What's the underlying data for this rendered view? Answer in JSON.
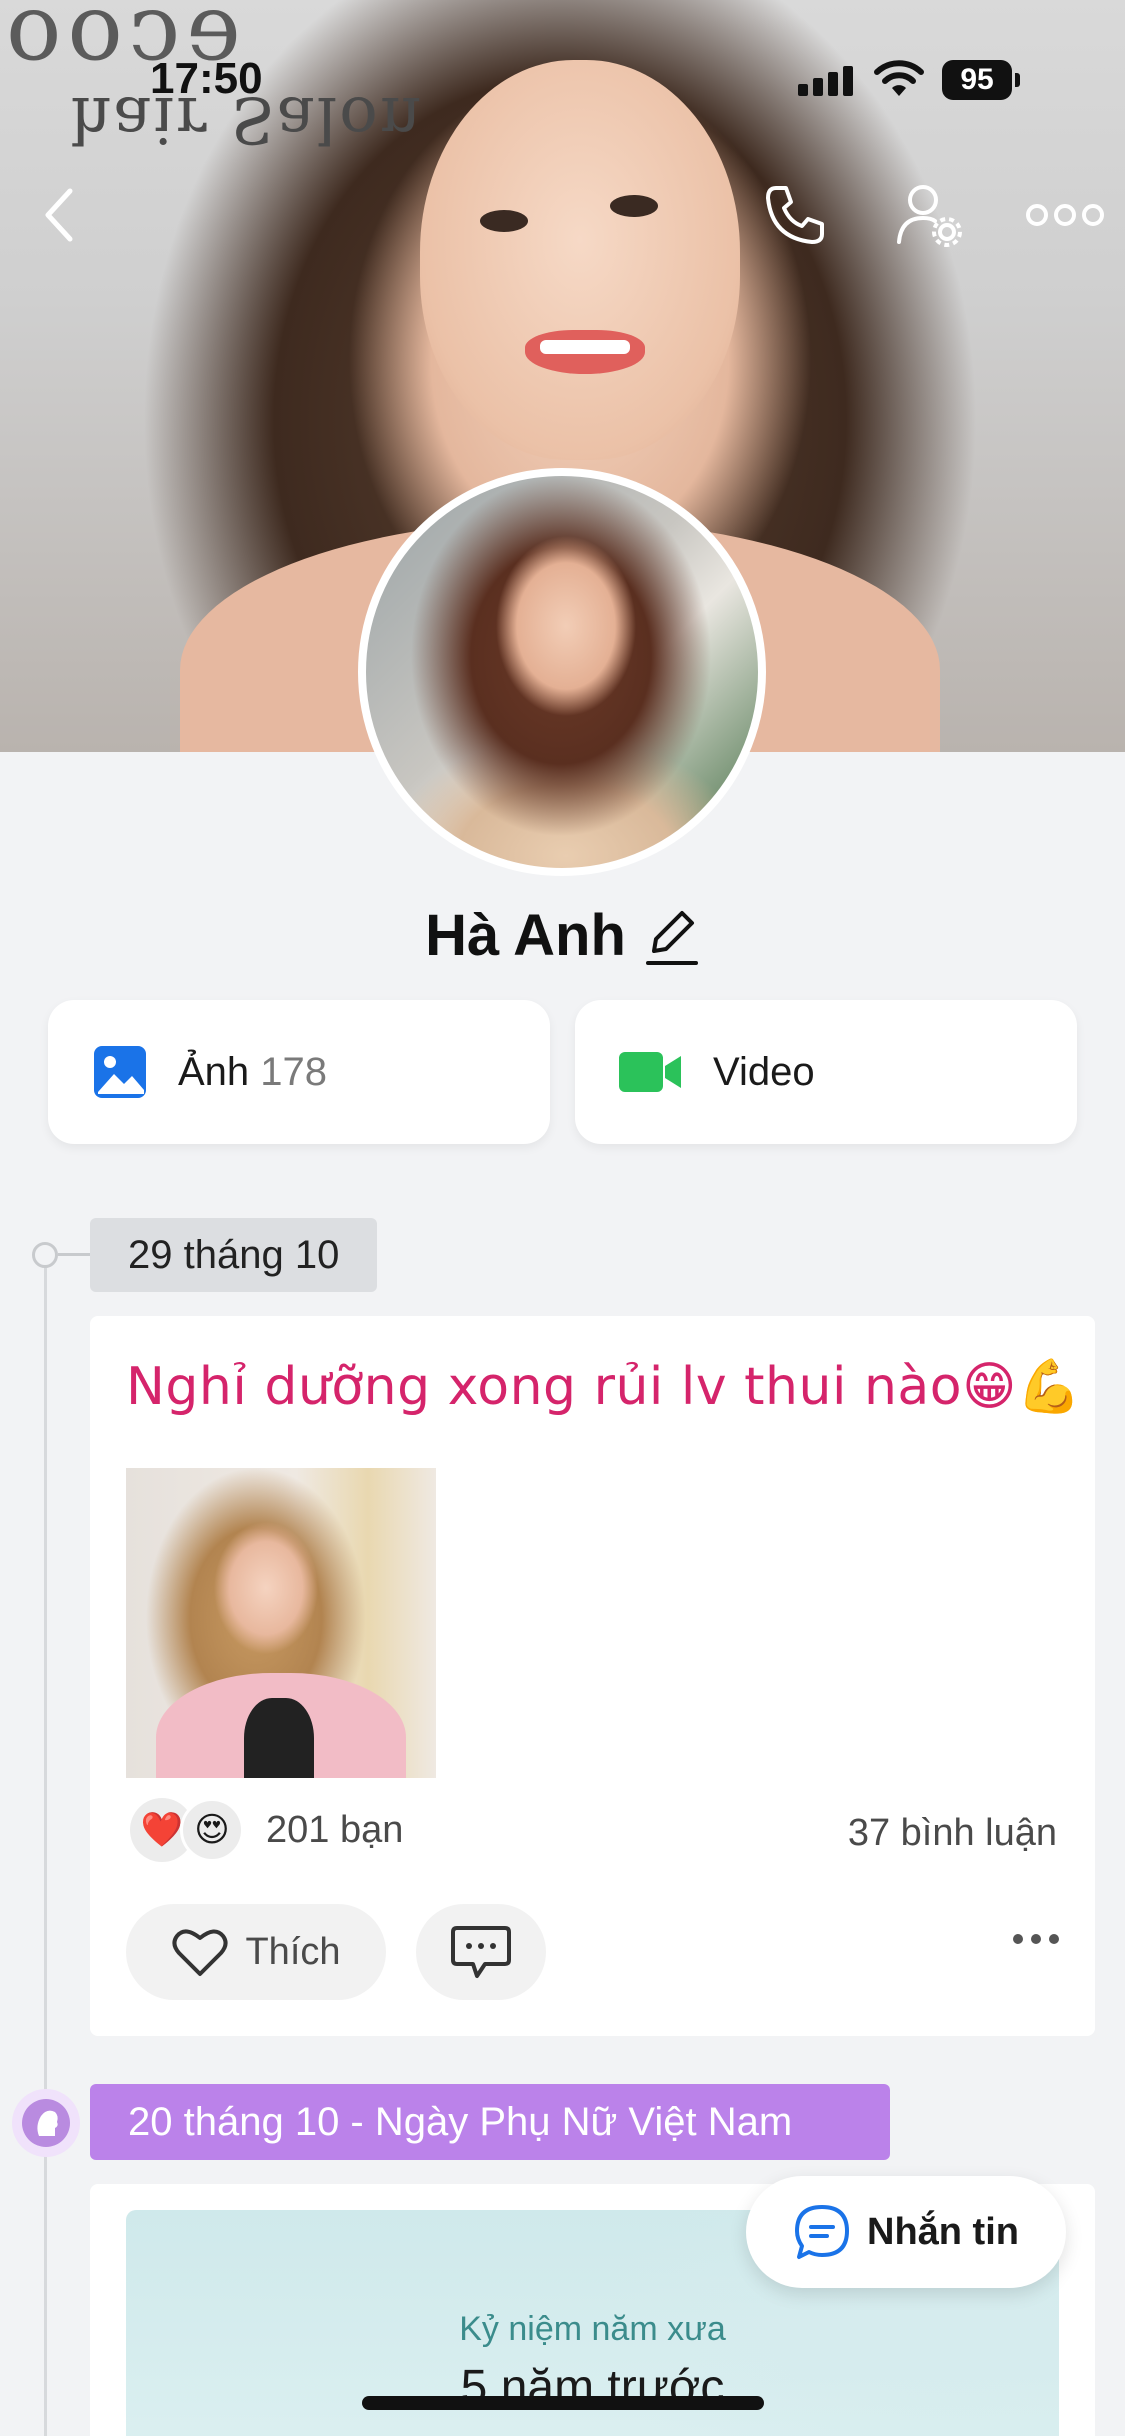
{
  "status_bar": {
    "time": "17:50",
    "battery": "95"
  },
  "cover": {
    "sign_text": "hair Salon",
    "sign_top_text": "ecoo"
  },
  "profile": {
    "name": "Hà Anh"
  },
  "media": {
    "photos_label": "Ảnh",
    "photos_count": "178",
    "video_label": "Video"
  },
  "timeline": [
    {
      "date": "29 tháng 10",
      "post_text": "Nghỉ dưỡng xong rủi lv thui nào😁💪",
      "reactions": [
        "❤️",
        "😍"
      ],
      "reaction_count": "201 bạn",
      "comment_count": "37 bình luận",
      "like_label": "Thích"
    },
    {
      "date": "20 tháng 10 - Ngày Phụ Nữ Việt Nam",
      "memory_label": "Kỷ niệm năm xưa",
      "memory_years": "5 năm trước"
    }
  ],
  "fab": {
    "message_label": "Nhắn tin"
  },
  "colors": {
    "accent_blue": "#1a73e8",
    "video_green": "#2bc25a",
    "post_text_pink": "#d5246b",
    "purple_chip": "#bb82ea"
  },
  "icons": [
    "back-icon",
    "phone-icon",
    "user-settings-icon",
    "more-icon",
    "edit-pencil-icon",
    "photo-icon",
    "video-camera-icon",
    "heart-icon",
    "comment-icon",
    "chat-bubble-icon"
  ]
}
